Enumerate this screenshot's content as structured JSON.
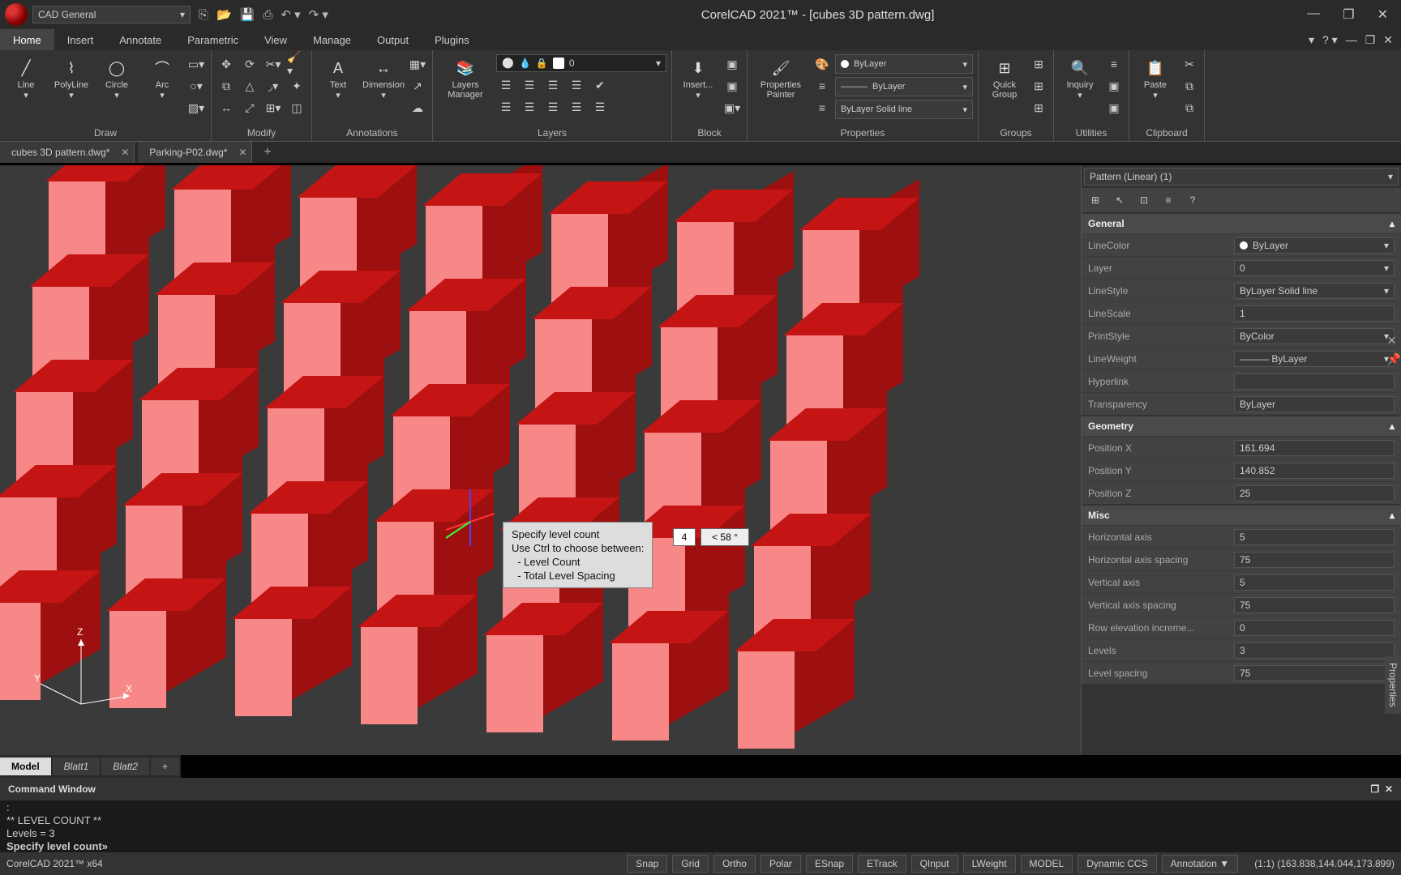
{
  "app": {
    "title": "CorelCAD 2021™ - [cubes 3D pattern.dwg]",
    "workspace": "CAD General"
  },
  "menu_tabs": [
    "Home",
    "Insert",
    "Annotate",
    "Parametric",
    "View",
    "Manage",
    "Output",
    "Plugins"
  ],
  "active_menu": 0,
  "ribbon": {
    "draw": {
      "label": "Draw",
      "items": [
        "Line",
        "PolyLine",
        "Circle",
        "Arc"
      ]
    },
    "modify": {
      "label": "Modify"
    },
    "annotations": {
      "label": "Annotations",
      "items": [
        "Text",
        "Dimension"
      ]
    },
    "layers": {
      "label": "Layers",
      "mgr": "Layers\nManager",
      "current": "0"
    },
    "block": {
      "label": "Block",
      "insert": "Insert..."
    },
    "properties": {
      "label": "Properties",
      "painter": "Properties\nPainter",
      "bylayer": "ByLayer",
      "linestyle": "ByLayer   Solid line"
    },
    "groups": {
      "label": "Groups",
      "quick": "Quick\nGroup"
    },
    "utilities": {
      "label": "Utilities",
      "inq": "Inquiry"
    },
    "clipboard": {
      "label": "Clipboard",
      "paste": "Paste"
    }
  },
  "doc_tabs": [
    "cubes 3D pattern.dwg*",
    "Parking-P02.dwg*"
  ],
  "tooltip": {
    "l1": "Specify level count",
    "l2": "Use Ctrl to choose between:",
    "l3": "  - Level Count",
    "l4": "  - Total Level Spacing"
  },
  "input": {
    "count": "4",
    "angle": "< 58  °"
  },
  "prop_panel": {
    "selection": "Pattern (Linear) (1)",
    "general_hdr": "General",
    "geometry_hdr": "Geometry",
    "misc_hdr": "Misc",
    "rows": {
      "linecolor_l": "LineColor",
      "linecolor_v": "ByLayer",
      "layer_l": "Layer",
      "layer_v": "0",
      "linestyle_l": "LineStyle",
      "linestyle_v": "ByLayer    Solid line",
      "linescale_l": "LineScale",
      "linescale_v": "1",
      "printstyle_l": "PrintStyle",
      "printstyle_v": "ByColor",
      "lineweight_l": "LineWeight",
      "lineweight_v": "——— ByLayer",
      "hyperlink_l": "Hyperlink",
      "hyperlink_v": "",
      "transp_l": "Transparency",
      "transp_v": "ByLayer",
      "posx_l": "Position X",
      "posx_v": "161.694",
      "posy_l": "Position Y",
      "posy_v": "140.852",
      "posz_l": "Position Z",
      "posz_v": "25",
      "hax_l": "Horizontal axis",
      "hax_v": "5",
      "haxs_l": "Horizontal axis spacing",
      "haxs_v": "75",
      "vax_l": "Vertical axis",
      "vax_v": "5",
      "vaxs_l": "Vertical axis spacing",
      "vaxs_v": "75",
      "rei_l": "Row elevation increme...",
      "rei_v": "0",
      "lev_l": "Levels",
      "lev_v": "3",
      "levs_l": "Level spacing",
      "levs_v": "75"
    }
  },
  "layout_tabs": [
    "Model",
    "Blatt1",
    "Blatt2"
  ],
  "cmd": {
    "title": "Command Window",
    "line1": ":",
    "line2": "** LEVEL COUNT **",
    "line3": "Levels = 3",
    "line4": "Specify level count»"
  },
  "status": {
    "app": "CorelCAD 2021™ x64",
    "btns": [
      "Snap",
      "Grid",
      "Ortho",
      "Polar",
      "ESnap",
      "ETrack",
      "QInput",
      "LWeight",
      "MODEL",
      "Dynamic CCS",
      "Annotation   ▼"
    ],
    "coords": "(1:1)  (163.838,144.044,173.899)"
  },
  "side_label": "Properties"
}
